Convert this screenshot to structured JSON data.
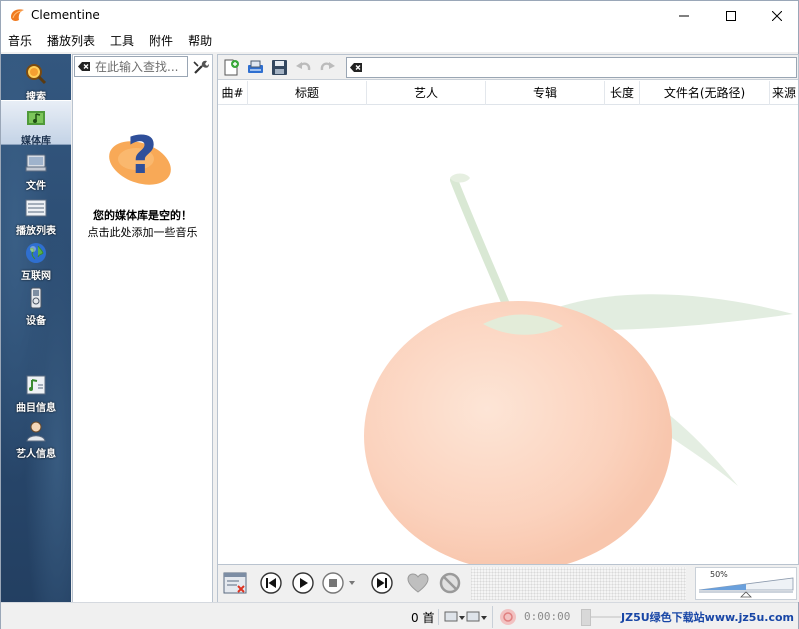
{
  "window": {
    "title": "Clementine"
  },
  "menu": [
    "音乐",
    "播放列表",
    "工具",
    "附件",
    "帮助"
  ],
  "tabs": [
    {
      "label": "搜索",
      "icon": "search-icon"
    },
    {
      "label": "媒体库",
      "icon": "library-icon",
      "active": true
    },
    {
      "label": "文件",
      "icon": "files-icon"
    },
    {
      "label": "播放列表",
      "icon": "playlists-icon"
    },
    {
      "label": "互联网",
      "icon": "internet-icon"
    },
    {
      "label": "设备",
      "icon": "devices-icon"
    },
    {
      "label": "曲目信息",
      "icon": "song-info-icon"
    },
    {
      "label": "艺人信息",
      "icon": "artist-info-icon"
    }
  ],
  "library": {
    "search_placeholder": "在此输入查找...",
    "empty_title": "您的媒体库是空的！",
    "empty_subtitle": "点击此处添加一些音乐"
  },
  "playlist": {
    "filter_value": "",
    "columns": [
      "曲#",
      "标题",
      "艺人",
      "专辑",
      "长度",
      "文件名(无路径)",
      "来源"
    ]
  },
  "player": {
    "volume_percent": "50%",
    "volume_level": 0.5
  },
  "status": {
    "track_count": "0 首",
    "position": "0:00:00",
    "watermark": "JZ5U绿色下载站www.jz5u.com"
  },
  "colors": {
    "accent_orange": "#f07a20",
    "tab_strip": "#2a4a6e",
    "watermark": "#1846a6"
  }
}
